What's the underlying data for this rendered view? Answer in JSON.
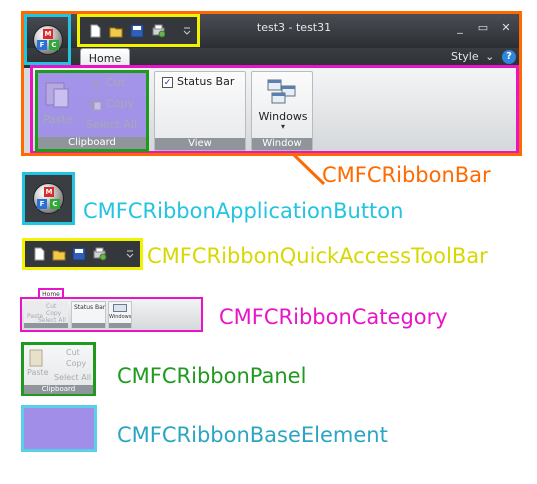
{
  "window": {
    "title_doc": "test3",
    "title_sep": " - ",
    "title_app": "test31",
    "min_glyph": "_",
    "max_glyph": "▭",
    "close_glyph": "✕",
    "style_label": "Style",
    "style_chevron": "⌄",
    "help_glyph": "?"
  },
  "app_button": {
    "letters": [
      "M",
      "F",
      "C"
    ]
  },
  "tabs": {
    "home": "Home"
  },
  "panels": {
    "clipboard": {
      "caption": "Clipboard",
      "paste": "Paste",
      "cut": "Cut",
      "copy": "Copy",
      "select_all": "Select All"
    },
    "view": {
      "caption": "View",
      "status_bar": "Status Bar"
    },
    "window": {
      "caption": "Window",
      "windows": "Windows",
      "arrow": "▾"
    }
  },
  "callout": {
    "ribbon_bar": "CMFCRibbonBar"
  },
  "legend": {
    "app_button": "CMFCRibbonApplicationButton",
    "qat": "CMFCRibbonQuickAccessToolBar",
    "category": "CMFCRibbonCategory",
    "panel": "CMFCRibbonPanel",
    "base_element": "CMFCRibbonBaseElement"
  },
  "colors": {
    "ribbon_bar": "#ff6a00",
    "app_button": "#22c4e0",
    "qat": "#f3f300",
    "category": "#e815c8",
    "panel": "#1f9a1f",
    "base_element_fill": "#9b8ae8",
    "base_element_border": "#5ad0e8"
  }
}
